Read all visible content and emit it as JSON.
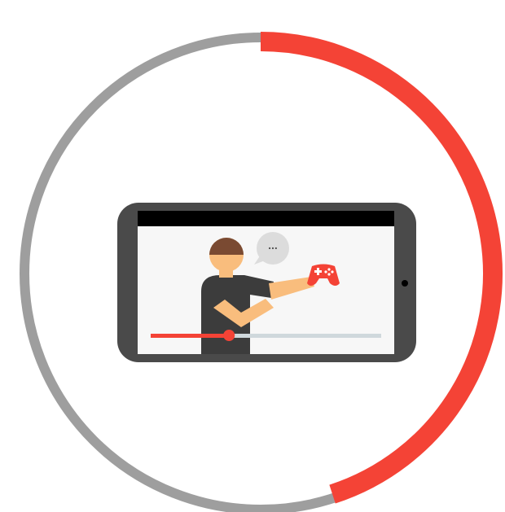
{
  "illustration": {
    "ring_progress": 0.45,
    "video_progress": 0.34,
    "speech_bubble_text": "...",
    "colors": {
      "accent": "#f44336",
      "ring_track": "#9e9e9e",
      "phone_body": "#4a4a4a",
      "screen_bg": "#f7f7f7",
      "screen_header": "#000000",
      "person_shirt": "#3c3c3c",
      "person_skin": "#f9bd7d",
      "person_hair": "#7a4a32",
      "bubble": "#dcdcdc",
      "progress_track": "#cfd8dc"
    },
    "icons": {
      "controller": "gamepad-icon",
      "bubble": "speech-bubble-icon",
      "camera": "camera-dot-icon"
    }
  }
}
